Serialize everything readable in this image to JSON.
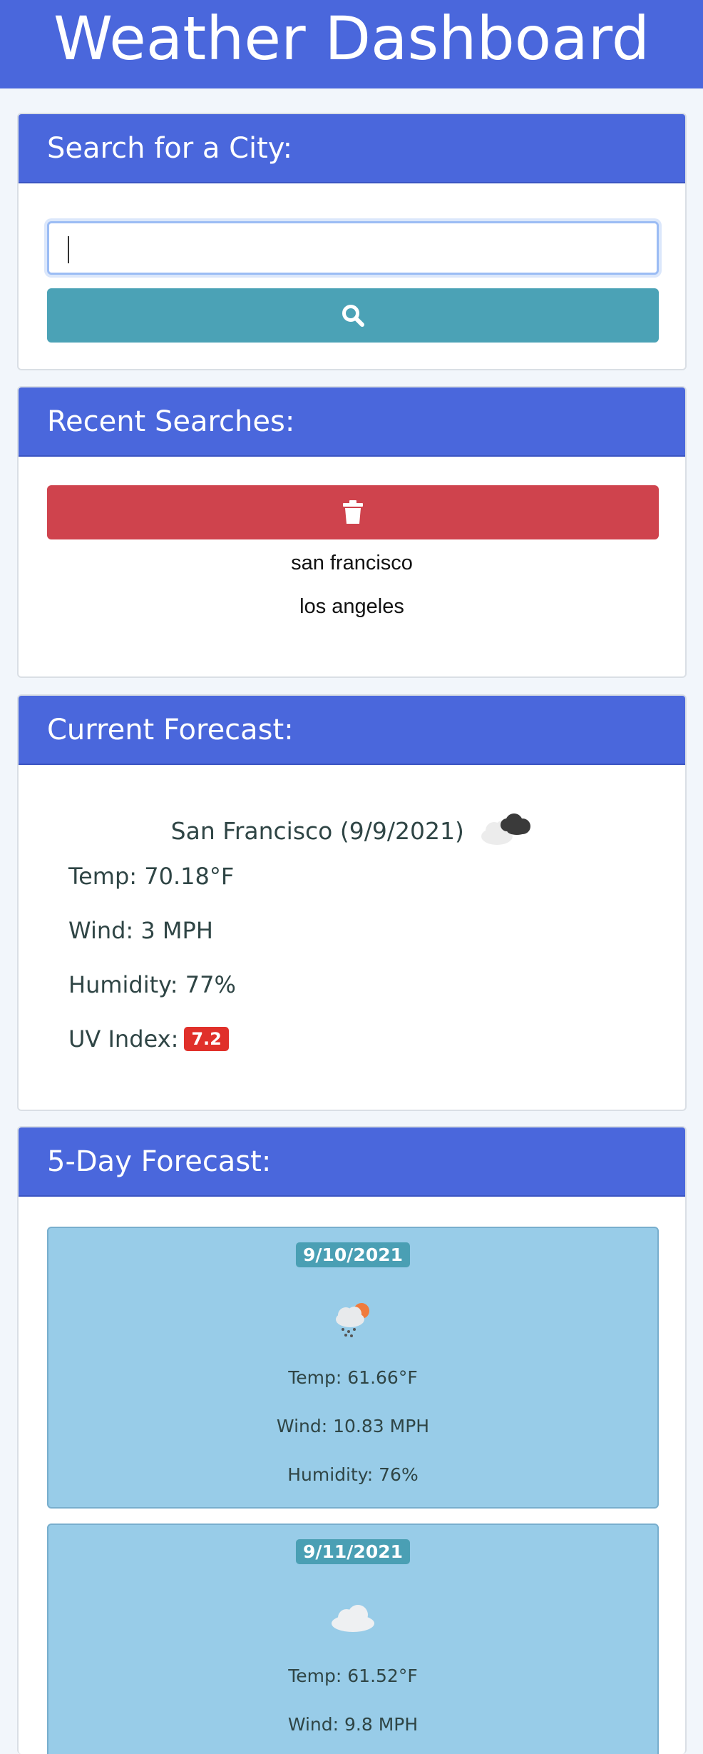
{
  "header": {
    "title": "Weather Dashboard"
  },
  "search": {
    "heading": "Search for a City:",
    "input_value": "",
    "button_icon": "search-icon"
  },
  "recent": {
    "heading": "Recent Searches:",
    "clear_icon": "trash-icon",
    "items": [
      "san francisco",
      "los angeles"
    ]
  },
  "current": {
    "heading": "Current Forecast:",
    "city_date": "San Francisco (9/9/2021)",
    "icon": "partly-cloudy-night-icon",
    "temp": "Temp: 70.18°F",
    "wind": "Wind: 3 MPH",
    "humidity": "Humidity: 77%",
    "uv_label": "UV Index:",
    "uv_value": "7.2",
    "uv_color": "#e0302a"
  },
  "forecast": {
    "heading": "5-Day Forecast:",
    "days": [
      {
        "date": "9/10/2021",
        "icon": "rain-sun-icon",
        "temp": "Temp: 61.66°F",
        "wind": "Wind: 10.83 MPH",
        "humidity": "Humidity: 76%"
      },
      {
        "date": "9/11/2021",
        "icon": "cloud-icon",
        "temp": "Temp: 61.52°F",
        "wind": "Wind: 9.8 MPH"
      }
    ]
  },
  "colors": {
    "brand": "#4a67dc",
    "search_button": "#4ba2b6",
    "clear_button": "#cf434d",
    "forecast_card": "#98cce8"
  }
}
